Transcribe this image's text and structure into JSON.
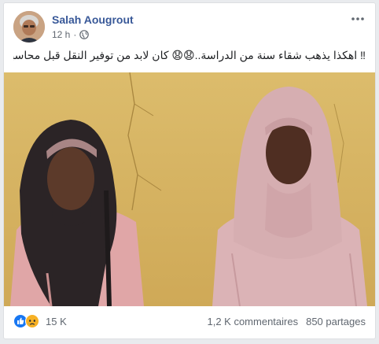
{
  "post": {
    "author": "Salah Aougrout",
    "time": "12 h",
    "separator": "·",
    "privacy_icon": "globe-icon",
    "text": "‼ اهكذا يذهب شقاء سنة من الدراسة..😧😧 كان لابد من توفير النقل قبل محاسبتهما..😒"
  },
  "photo": {
    "background_color": "#d9b664"
  },
  "footer": {
    "reaction_icons": [
      "like-icon",
      "sad-icon"
    ],
    "reaction_count": "15 K",
    "comments": "1,2 K commentaires",
    "shares": "850 partages"
  },
  "colors": {
    "author": "#385898",
    "meta": "#606770",
    "like_blue": "#1877f2",
    "sad_yellow": "#f7b125"
  }
}
